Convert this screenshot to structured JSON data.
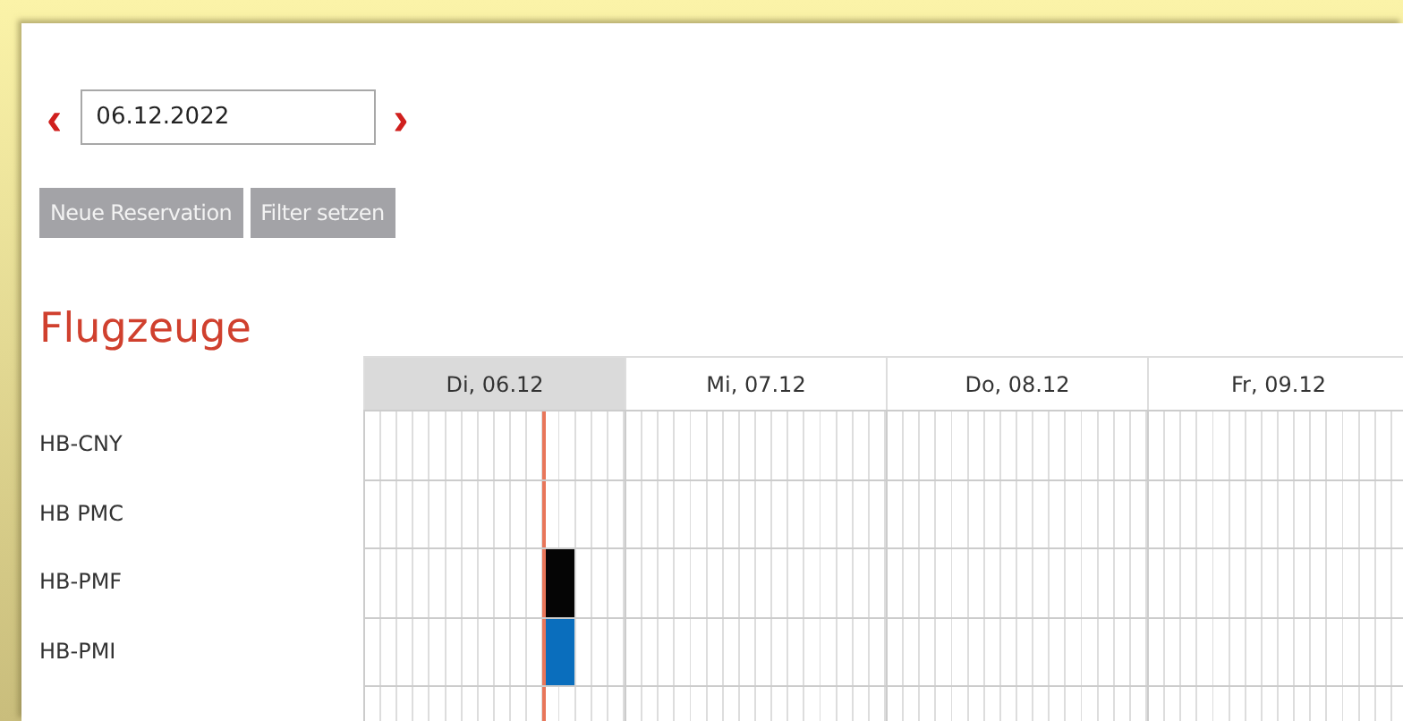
{
  "date_nav": {
    "prev": "‹",
    "value": "06.12.2022",
    "next": "›"
  },
  "buttons": [
    "Neue Reservation",
    "Filter setzen"
  ],
  "title": "Flugzeuge",
  "days": [
    {
      "label": "Di, 06.12",
      "selected": true
    },
    {
      "label": "Mi, 07.12",
      "selected": false
    },
    {
      "label": "Do, 08.12",
      "selected": false
    },
    {
      "label": "Fr, 09.12",
      "selected": false
    }
  ],
  "aircraft": [
    {
      "name": "HB-CNY"
    },
    {
      "name": "HB PMC"
    },
    {
      "name": "HB-PMF",
      "bookings": [
        {
          "color": "#050505"
        }
      ]
    },
    {
      "name": "HB-PMI",
      "bookings": [
        {
          "color": "#0a6ebd"
        }
      ]
    }
  ]
}
